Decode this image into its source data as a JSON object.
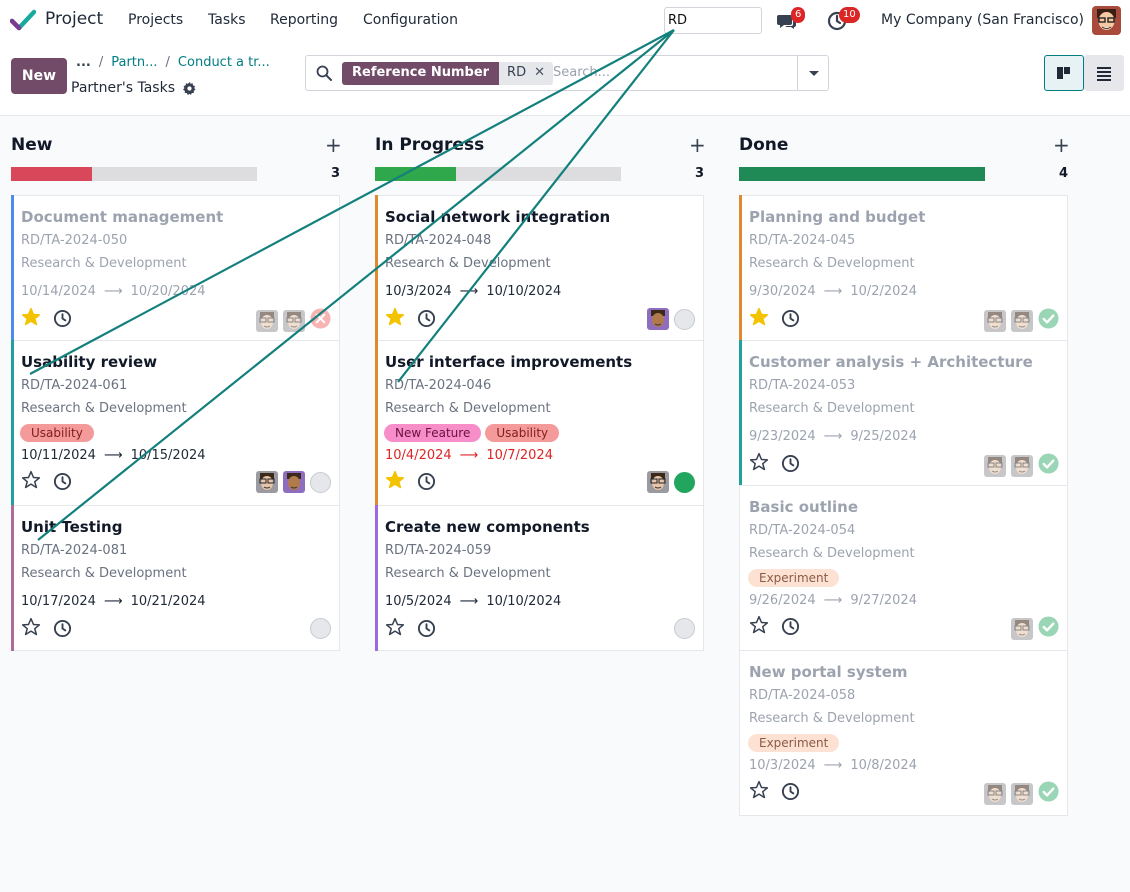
{
  "app": {
    "name": "Project"
  },
  "menu": [
    "Projects",
    "Tasks",
    "Reporting",
    "Configuration"
  ],
  "navbar": {
    "search_value": "RD",
    "messages_count": "6",
    "activities_count": "10",
    "company": "My Company (San Francisco)"
  },
  "control_panel": {
    "new_label": "New",
    "breadcrumb": [
      "...",
      "Partn...",
      "Conduct a tr..."
    ],
    "page_title": "Partner's Tasks"
  },
  "search": {
    "facet_label": "Reference Number",
    "facet_value": "RD",
    "placeholder": "Search..."
  },
  "colors": {
    "brand": "#714b67",
    "accent": "#017e84",
    "danger": "#dc2626",
    "success": "#22a55f"
  },
  "columns": [
    {
      "title": "New",
      "count": "3",
      "progress_red": 0.33,
      "progress_green": 0,
      "progress_color": "#d9475b"
    },
    {
      "title": "In Progress",
      "count": "3",
      "progress_red": 0,
      "progress_green": 0.33,
      "progress_color": "#2ea84a"
    },
    {
      "title": "Done",
      "count": "4",
      "progress_red": 0,
      "progress_green": 1.0,
      "progress_color": "#1f8a55"
    }
  ],
  "cards": {
    "new": [
      {
        "title": "Document management",
        "ref": "RD/TA-2024-050",
        "project": "Research & Development",
        "start": "10/14/2024",
        "end": "10/20/2024",
        "starred": true,
        "status": "blocked",
        "faded": true
      },
      {
        "title": "Usability review",
        "ref": "RD/TA-2024-061",
        "project": "Research & Development",
        "tags": [
          "Usability"
        ],
        "start": "10/11/2024",
        "end": "10/15/2024",
        "starred": false,
        "status": "normal"
      },
      {
        "title": "Unit Testing",
        "ref": "RD/TA-2024-081",
        "project": "Research & Development",
        "start": "10/17/2024",
        "end": "10/21/2024",
        "starred": false,
        "status": "normal"
      }
    ],
    "progress": [
      {
        "title": "Social network integration",
        "ref": "RD/TA-2024-048",
        "project": "Research & Development",
        "start": "10/3/2024",
        "end": "10/10/2024",
        "starred": true,
        "status": "normal"
      },
      {
        "title": "User interface improvements",
        "ref": "RD/TA-2024-046",
        "project": "Research & Development",
        "tags": [
          "New Feature",
          "Usability"
        ],
        "start": "10/4/2024",
        "end": "10/7/2024",
        "starred": true,
        "status": "done",
        "overdue": true
      },
      {
        "title": "Create new components",
        "ref": "RD/TA-2024-059",
        "project": "Research & Development",
        "start": "10/5/2024",
        "end": "10/10/2024",
        "starred": false,
        "status": "normal"
      }
    ],
    "done": [
      {
        "title": "Planning and budget",
        "ref": "RD/TA-2024-045",
        "project": "Research & Development",
        "start": "9/30/2024",
        "end": "10/2/2024",
        "starred": true,
        "status": "done"
      },
      {
        "title": "Customer analysis + Architecture",
        "ref": "RD/TA-2024-053",
        "project": "Research & Development",
        "start": "9/23/2024",
        "end": "9/25/2024",
        "starred": false,
        "status": "done"
      },
      {
        "title": "Basic outline",
        "ref": "RD/TA-2024-054",
        "project": "Research & Development",
        "tags": [
          "Experiment"
        ],
        "start": "9/26/2024",
        "end": "9/27/2024",
        "starred": false,
        "status": "done"
      },
      {
        "title": "New portal system",
        "ref": "RD/TA-2024-058",
        "project": "Research & Development",
        "tags": [
          "Experiment"
        ],
        "start": "10/3/2024",
        "end": "10/8/2024",
        "starred": false,
        "status": "done"
      }
    ]
  }
}
